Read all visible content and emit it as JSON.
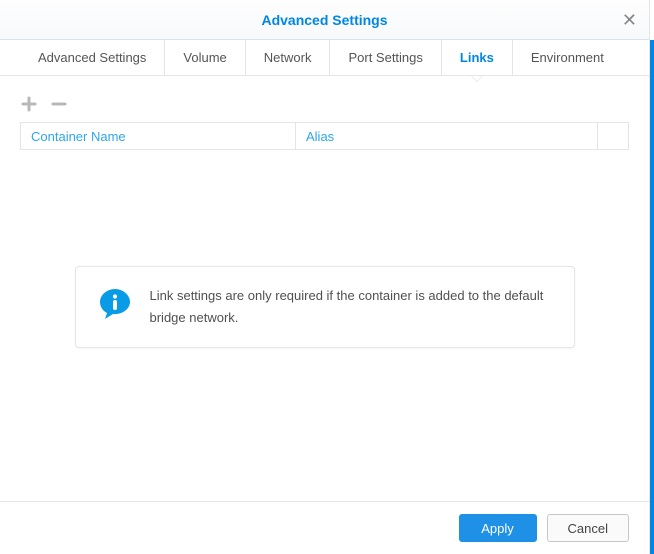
{
  "title": "Advanced Settings",
  "tabs": [
    {
      "label": "Advanced Settings",
      "active": false
    },
    {
      "label": "Volume",
      "active": false
    },
    {
      "label": "Network",
      "active": false
    },
    {
      "label": "Port Settings",
      "active": false
    },
    {
      "label": "Links",
      "active": true
    },
    {
      "label": "Environment",
      "active": false
    }
  ],
  "table": {
    "columns": {
      "container": "Container Name",
      "alias": "Alias"
    },
    "rows": []
  },
  "info": {
    "message": "Link settings are only required if the container is added to the default bridge network."
  },
  "buttons": {
    "apply": "Apply",
    "cancel": "Cancel"
  }
}
